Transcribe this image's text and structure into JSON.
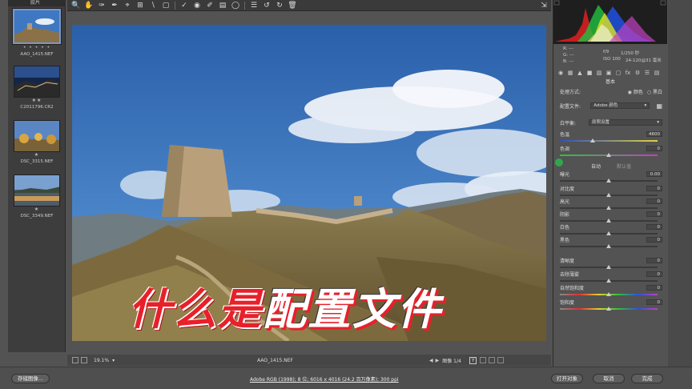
{
  "filmstrip": {
    "header": "胶片",
    "items": [
      {
        "name": "AAO_1415.NEF",
        "stars": "• • • • •",
        "selected": true
      },
      {
        "name": "C2011796.CR2",
        "stars": "★★",
        "selected": false
      },
      {
        "name": "DSC_3315.NEF",
        "stars": "★",
        "selected": false
      },
      {
        "name": "DSC_3349.NEF",
        "stars": "★",
        "selected": false
      }
    ]
  },
  "toolbar": {
    "icons": [
      "zoom-icon",
      "hand-icon",
      "white-balance-icon",
      "color-sampler-icon",
      "target-adjust-icon",
      "crop-icon",
      "straighten-icon",
      "transform-icon",
      "spot-removal-icon",
      "red-eye-icon",
      "adjustment-brush-icon",
      "graduated-filter-icon",
      "radial-filter-icon",
      "preferences-icon",
      "rotate-left-icon",
      "rotate-right-icon",
      "trash-icon"
    ],
    "open_panel_icon": "panel-icon"
  },
  "preview": {
    "zoom": "19.1%",
    "filename": "AAO_1415.NEF",
    "image_counter": "图像 1/4"
  },
  "caption": {
    "red": "什么是",
    "white": "配置文件"
  },
  "info": {
    "r_label": "R:",
    "g_label": "G:",
    "b_label": "B:",
    "r_val": "---",
    "g_val": "---",
    "b_val": "---",
    "aperture": "f/9",
    "shutter": "1/250 秒",
    "iso": "ISO 100",
    "lens": "24-120@31 毫米"
  },
  "basic": {
    "section_title": "基本",
    "treatment_label": "处理方式:",
    "treatment_color": "颜色",
    "treatment_bw": "黑白",
    "profile_label": "配置文件:",
    "profile_value": "Adobe 颜色",
    "wb_label": "白平衡:",
    "wb_value": "原照设置",
    "auto_label": "自动",
    "default_label": "默认值",
    "sliders": [
      {
        "label": "色温",
        "value": "4600"
      },
      {
        "label": "色调",
        "value": "0"
      },
      {
        "label": "曝光",
        "value": "0.00"
      },
      {
        "label": "对比度",
        "value": "0"
      },
      {
        "label": "高光",
        "value": "0"
      },
      {
        "label": "阴影",
        "value": "0"
      },
      {
        "label": "白色",
        "value": "0"
      },
      {
        "label": "黑色",
        "value": "0"
      },
      {
        "label": "清晰度",
        "value": "0"
      },
      {
        "label": "去除薄雾",
        "value": "0"
      },
      {
        "label": "自然饱和度",
        "value": "0"
      },
      {
        "label": "饱和度",
        "value": "0"
      }
    ]
  },
  "bottom": {
    "save_label": "存储图像...",
    "workflow_info": "Adobe RGB (1998); 8 位; 6016 x 4016 (24.2 百万像素); 300 ppi",
    "open_label": "打开对象",
    "cancel_label": "取消",
    "done_label": "完成"
  },
  "colors": {
    "accent": "#e8202a",
    "panel": "#535353",
    "sky": "#2f6bb8"
  }
}
